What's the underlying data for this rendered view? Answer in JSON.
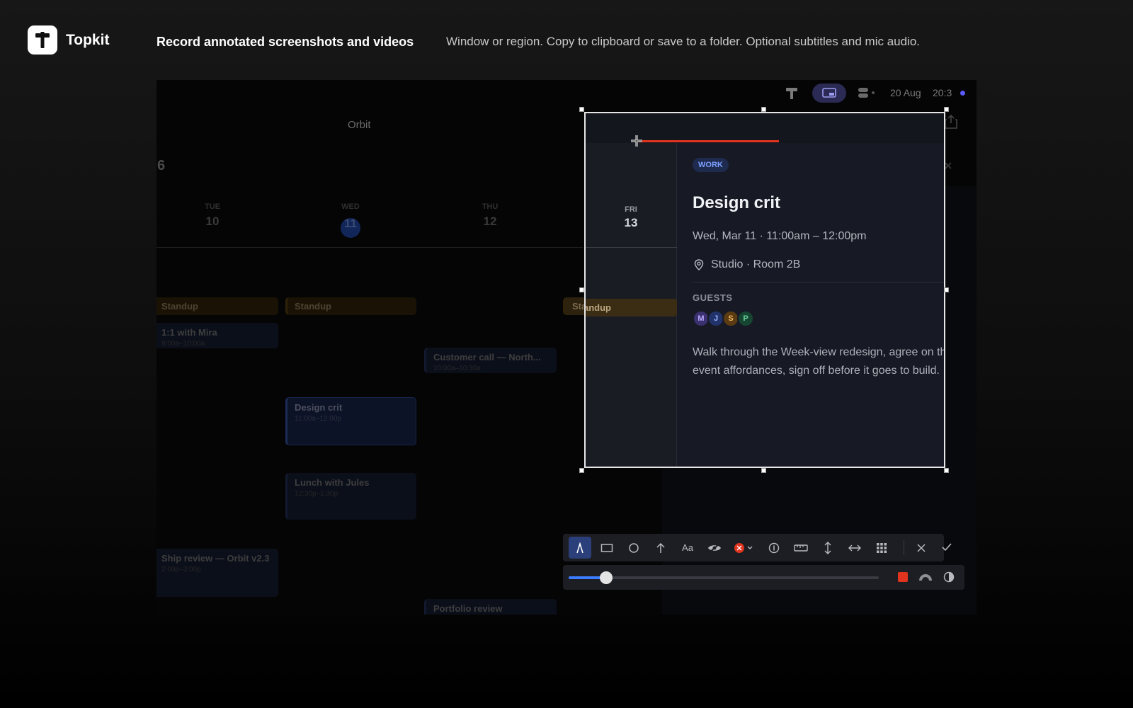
{
  "header": {
    "brand": "Topkit",
    "headline": "Record annotated screenshots and videos",
    "subline": "Window or region. Copy to clipboard or save to a folder. Optional subtitles and mic audio."
  },
  "menubar": {
    "date": "20 Aug",
    "time": "20:3"
  },
  "calendar": {
    "app_title": "Orbit",
    "year_fragment": "6",
    "days": [
      {
        "label": "TUE",
        "num": "10"
      },
      {
        "label": "WED",
        "num": "11"
      },
      {
        "label": "THU",
        "num": "12"
      },
      {
        "label": "FRI",
        "num": "13"
      }
    ],
    "events": {
      "standup_tue": {
        "title": "Standup"
      },
      "standup_wed": {
        "title": "Standup"
      },
      "standup_fri": {
        "title": "Standup"
      },
      "mira": {
        "title": "1:1 with Mira",
        "time": "9:00a–10:00a"
      },
      "customer": {
        "title": "Customer call — North...",
        "time": "10:00a–10:30a"
      },
      "design_crit": {
        "title": "Design crit",
        "time": "11:00a–12:00p"
      },
      "lunch": {
        "title": "Lunch with Jules",
        "time": "12:30p–1:30p"
      },
      "ship": {
        "title": "Ship review — Orbit v2.3",
        "time": "2:00p–3:00p"
      },
      "portfolio": {
        "title": "Portfolio review"
      }
    }
  },
  "detail": {
    "tag": "WORK",
    "title": "Design crit",
    "time": "Wed, Mar 11 · 11:00am – 12:00pm",
    "location": "Studio · Room 2B",
    "guests_label": "GUESTS",
    "guests": [
      {
        "initial": "M",
        "bg": "#3b3170",
        "fg": "#b9a9ff"
      },
      {
        "initial": "J",
        "bg": "#22336b",
        "fg": "#9bb5ff"
      },
      {
        "initial": "S",
        "bg": "#5a3b12",
        "fg": "#f0b561"
      },
      {
        "initial": "P",
        "bg": "#164532",
        "fg": "#6fd7a3"
      }
    ],
    "description": "Walk through the Week-view redesign, agree on the event affordances, sign off before it goes to build."
  },
  "toolbar": {
    "text_tool_label": "Aa",
    "active_tool": "pen-tool",
    "tools": [
      "pen-tool",
      "rectangle-tool",
      "circle-tool",
      "arrow-tool",
      "text-tool",
      "blur-tool",
      "color-picker",
      "counter-tool",
      "ruler-tool",
      "vertical-measure-tool",
      "horizontal-measure-tool",
      "grid-tool",
      "cancel",
      "confirm"
    ]
  },
  "stroke": {
    "width_fraction": 0.12,
    "color": "#e0341f"
  },
  "colors": {
    "accent": "#3b7cff",
    "annotation": "#e0341f",
    "tag": "#7ca0ff"
  }
}
